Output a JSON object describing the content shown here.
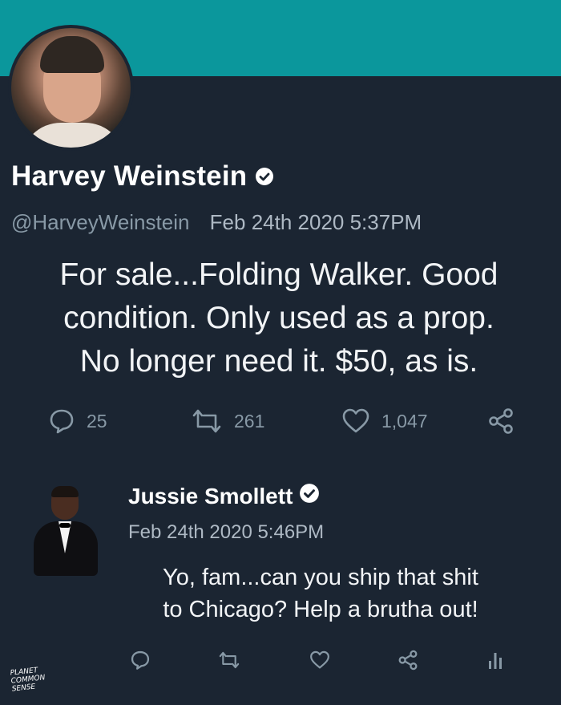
{
  "author": {
    "display_name": "Harvey Weinstein",
    "handle": "@HarveyWeinstein",
    "timestamp": "Feb 24th 2020 5:37PM",
    "verified": true
  },
  "tweet": {
    "lines": [
      "For sale...Folding Walker. Good",
      "condition. Only used as a prop.",
      "No longer need it. $50, as is."
    ]
  },
  "stats": {
    "replies": "25",
    "retweets": "261",
    "likes": "1,047"
  },
  "reply": {
    "display_name": "Jussie Smollett",
    "timestamp": "Feb 24th 2020 5:46PM",
    "verified": true,
    "lines": [
      "Yo, fam...can you ship that shit",
      "to Chicago? Help a brutha out!"
    ]
  },
  "watermark": {
    "lines": [
      "PLANET",
      "COMMON",
      "SENSE"
    ]
  },
  "colors": {
    "banner": "#0b979c",
    "background": "#1b2532",
    "muted": "#8899a6",
    "text": "#ffffff"
  },
  "icons": {
    "reply": "comment-bubble-icon",
    "retweet": "retweet-arrows-icon",
    "like": "heart-icon",
    "share": "share-nodes-icon",
    "analytics": "bar-chart-icon",
    "verified": "verified-badge-icon"
  }
}
